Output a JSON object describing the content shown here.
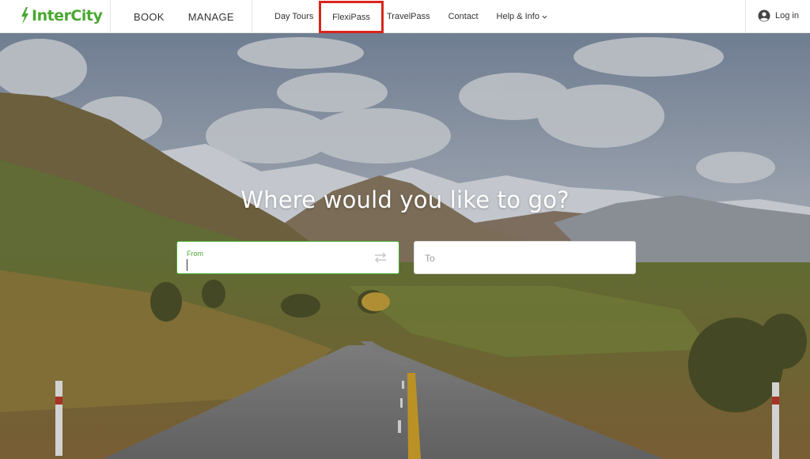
{
  "header": {
    "brand": "InterCity",
    "primary_nav": [
      "BOOK",
      "MANAGE"
    ],
    "secondary_nav": {
      "day_tours": "Day Tours",
      "flexipass": "FlexiPass",
      "travelpass": "TravelPass",
      "contact": "Contact",
      "help_info": "Help & Info"
    },
    "login": "Log in"
  },
  "hero": {
    "title": "Where would you like to go?",
    "from_label": "From",
    "to_placeholder": "To"
  },
  "colors": {
    "brand_green": "#4aa832",
    "highlight_red": "#d9251c"
  },
  "icons": [
    "intercity-logo-icon",
    "user-circle-icon",
    "chevron-down-icon",
    "swap-arrows-icon"
  ]
}
